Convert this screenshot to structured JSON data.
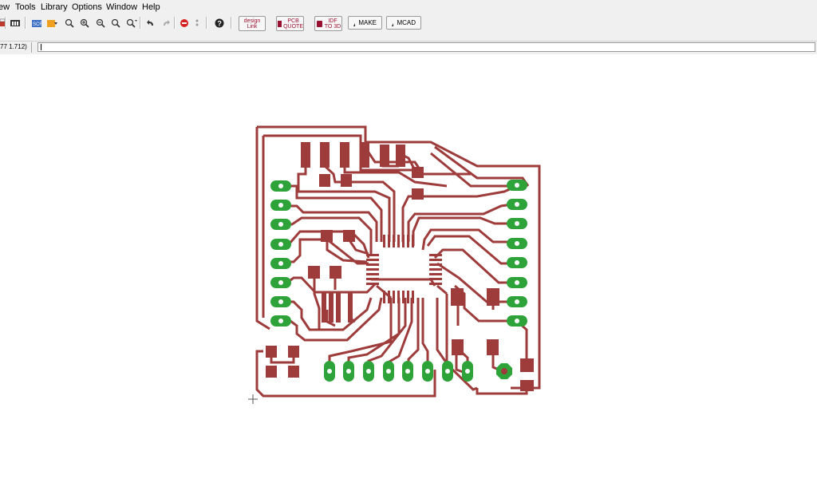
{
  "menu": [
    "ew",
    "Tools",
    "Library",
    "Options",
    "Window",
    "Help"
  ],
  "toolbar": {
    "icons": [
      "print-icon",
      "cam-icon",
      "script-icon",
      "run-icon",
      "zoom-fit-icon",
      "zoom-in-icon",
      "zoom-out-icon",
      "zoom-previous-icon",
      "zoom-select-icon",
      "undo-icon",
      "redo-icon",
      "stop-icon",
      "go-icon",
      "help-icon"
    ],
    "fusion": [
      {
        "line1": "design",
        "line2": "Link"
      },
      {
        "line1": "PCB",
        "line2": "QUOTE"
      },
      {
        "line1": "IDF",
        "line2": "TO 3D"
      }
    ],
    "make_label": "MAKE",
    "mcad_label": "MCAD"
  },
  "command": {
    "coordinate": "77 1.712)",
    "input_value": ""
  },
  "board": {
    "trace_color": "#9e3c3c",
    "pad_color": "#2ea33a",
    "smd_color": "#9e3c3c"
  }
}
